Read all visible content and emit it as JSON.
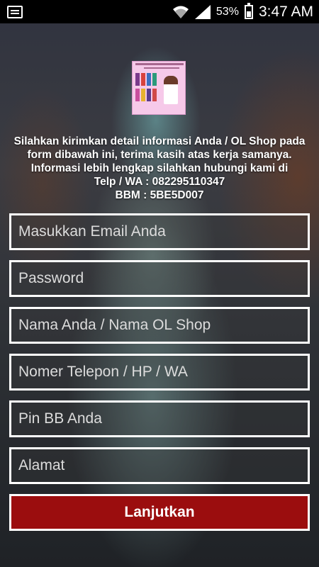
{
  "statusbar": {
    "battery_percent": "53%",
    "time": "3:47 AM"
  },
  "info": {
    "line1": "Silahkan kirimkan detail informasi Anda / OL Shop pada",
    "line2": "form dibawah ini, terima kasih atas kerja samanya.",
    "line3": "Informasi lebih lengkap silahkan hubungi kami di",
    "line4": "Telp / WA : 082295110347",
    "line5": "BBM : 5BE5D007"
  },
  "form": {
    "email_placeholder": "Masukkan Email Anda",
    "password_placeholder": "Password",
    "name_placeholder": "Nama Anda / Nama OL Shop",
    "phone_placeholder": "Nomer Telepon / HP / WA",
    "pin_placeholder": "Pin BB Anda",
    "address_placeholder": "Alamat",
    "submit_label": "Lanjutkan"
  },
  "colors": {
    "accent": "#9b0d0e",
    "field_border": "#ffffff",
    "statusbar": "#000000"
  }
}
